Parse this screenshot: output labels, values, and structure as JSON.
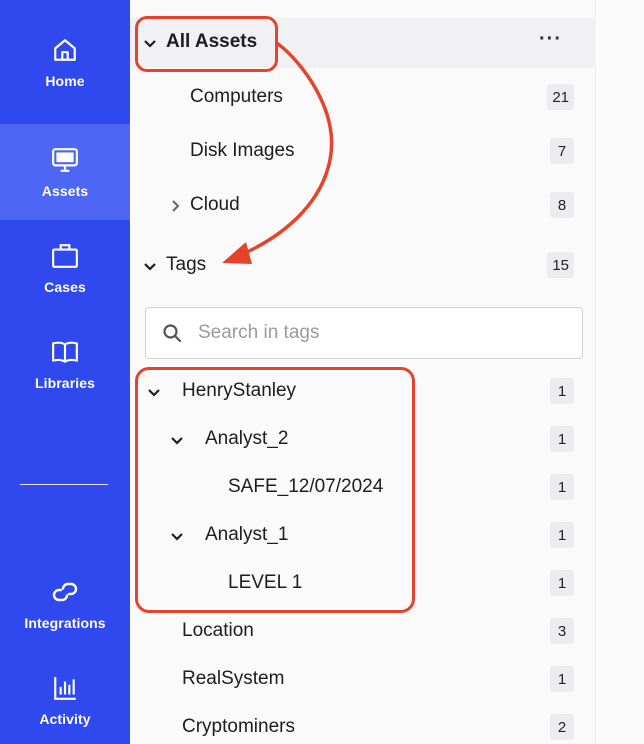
{
  "nav": {
    "items": [
      {
        "label": "Home",
        "icon": "home-icon"
      },
      {
        "label": "Assets",
        "icon": "monitor-icon",
        "active": true
      },
      {
        "label": "Cases",
        "icon": "briefcase-icon"
      },
      {
        "label": "Libraries",
        "icon": "book-icon"
      },
      {
        "label": "Integrations",
        "icon": "link-icon"
      },
      {
        "label": "Activity",
        "icon": "bar-chart-icon"
      }
    ]
  },
  "assets": {
    "title": "All Assets",
    "more": "···",
    "items": [
      {
        "label": "Computers",
        "count": "21"
      },
      {
        "label": "Disk Images",
        "count": "7"
      },
      {
        "label": "Cloud",
        "count": "8"
      }
    ]
  },
  "tags": {
    "title": "Tags",
    "count": "15",
    "search_placeholder": "Search in tags",
    "items": [
      {
        "label": "HenryStanley",
        "count": "1"
      },
      {
        "label": "Analyst_2",
        "count": "1"
      },
      {
        "label": "SAFE_12/07/2024",
        "count": "1"
      },
      {
        "label": "Analyst_1",
        "count": "1"
      },
      {
        "label": "LEVEL 1",
        "count": "1"
      },
      {
        "label": "Location",
        "count": "3"
      },
      {
        "label": "RealSystem",
        "count": "1"
      },
      {
        "label": "Cryptominers",
        "count": "2"
      }
    ]
  },
  "colors": {
    "nav_bg": "#2f49ee",
    "nav_active": "#4d66f4",
    "annotation": "#e5432c"
  }
}
